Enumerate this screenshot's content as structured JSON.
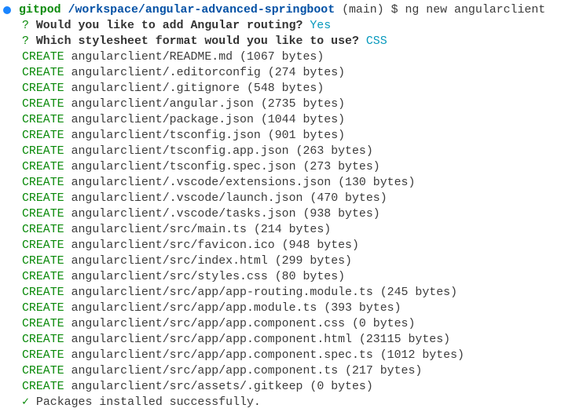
{
  "prompt": {
    "user": "gitpod",
    "path": "/workspace/angular-advanced-springboot",
    "branch": "(main)",
    "symbol": "$",
    "command": "ng new angularclient"
  },
  "questions": [
    {
      "mark": "?",
      "text": "Would you like to add Angular routing?",
      "answer": "Yes"
    },
    {
      "mark": "?",
      "text": "Which stylesheet format would you like to use?",
      "answer": "CSS"
    }
  ],
  "create_label": "CREATE",
  "files": [
    "angularclient/README.md (1067 bytes)",
    "angularclient/.editorconfig (274 bytes)",
    "angularclient/.gitignore (548 bytes)",
    "angularclient/angular.json (2735 bytes)",
    "angularclient/package.json (1044 bytes)",
    "angularclient/tsconfig.json (901 bytes)",
    "angularclient/tsconfig.app.json (263 bytes)",
    "angularclient/tsconfig.spec.json (273 bytes)",
    "angularclient/.vscode/extensions.json (130 bytes)",
    "angularclient/.vscode/launch.json (470 bytes)",
    "angularclient/.vscode/tasks.json (938 bytes)",
    "angularclient/src/main.ts (214 bytes)",
    "angularclient/src/favicon.ico (948 bytes)",
    "angularclient/src/index.html (299 bytes)",
    "angularclient/src/styles.css (80 bytes)",
    "angularclient/src/app/app-routing.module.ts (245 bytes)",
    "angularclient/src/app/app.module.ts (393 bytes)",
    "angularclient/src/app/app.component.css (0 bytes)",
    "angularclient/src/app/app.component.html (23115 bytes)",
    "angularclient/src/app/app.component.spec.ts (1012 bytes)",
    "angularclient/src/app/app.component.ts (217 bytes)",
    "angularclient/src/assets/.gitkeep (0 bytes)"
  ],
  "final": {
    "icon": "✓",
    "text": "Packages installed successfully."
  },
  "colors": {
    "green": "#0b8a0b",
    "blue": "#0451a5",
    "answer": "#0598bc",
    "dot": "#1a85ff"
  }
}
